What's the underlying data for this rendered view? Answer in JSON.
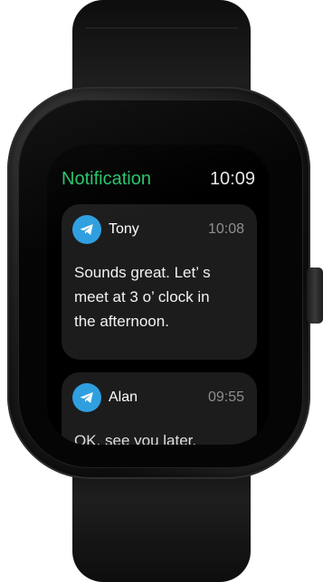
{
  "screen": {
    "title": "Notification",
    "time": "10:09"
  },
  "notifications": [
    {
      "app_icon": "telegram-icon",
      "sender": "Tony",
      "time": "10:08",
      "message": "Sounds great. Let’ s\nmeet at 3 o’ clock in\nthe afternoon."
    },
    {
      "app_icon": "telegram-icon",
      "sender": "Alan",
      "time": "09:55",
      "message": "OK, see you later."
    }
  ],
  "colors": {
    "accent": "#27c46a",
    "icon_blue": "#2f9fe0",
    "card_bg": "#1c1c1c"
  }
}
